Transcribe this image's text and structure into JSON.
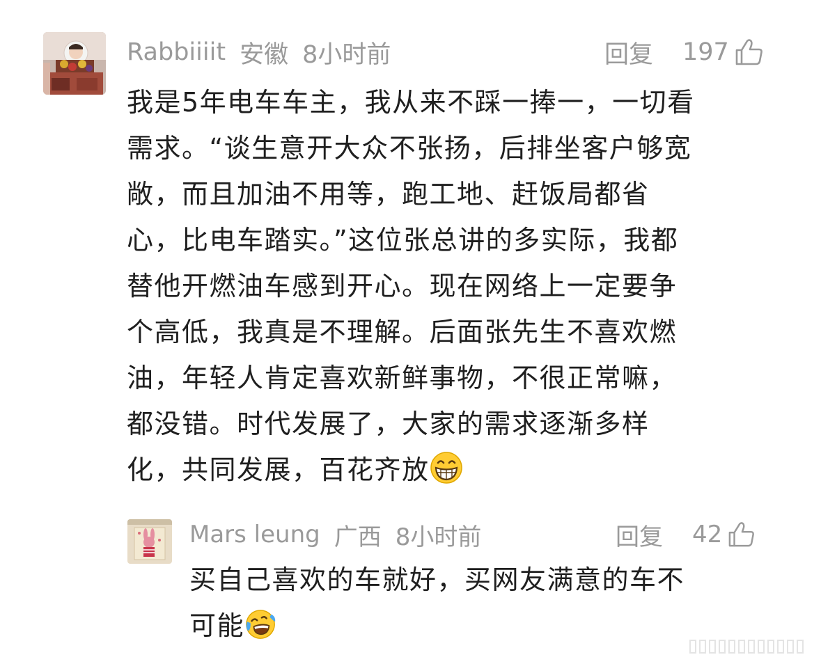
{
  "comment": {
    "username": "Rabbiiiit",
    "location": "安徽",
    "time": "8小时前",
    "reply_label": "回复",
    "likes": "197",
    "lines": [
      "我是5年电车车主，我从来不踩一捧一，一切看",
      "需求。“谈生意开大众不张扬，后排坐客户够宽",
      "敞，而且加油不用等，跑工地、赶饭局都省",
      "心，比电车踏实。”这位张总讲的多实际，我都",
      "替他开燃油车感到开心。现在网络上一定要争",
      "个高低，我真是不理解。后面张先生不喜欢燃",
      "油，年轻人肯定喜欢新鲜事物，不很正常嘛，",
      "都没错。时代发展了，大家的需求逐渐多样",
      "化，共同发展，百花齐放"
    ],
    "end_emoji": "grinning-face-emoji"
  },
  "reply": {
    "username": "Mars leung",
    "location": "广西",
    "time": "8小时前",
    "reply_label": "回复",
    "likes": "42",
    "lines": [
      "买自己喜欢的车就好，买网友满意的车不",
      "可能"
    ],
    "end_emoji": "laughing-crying-emoji"
  },
  "colors": {
    "meta_text": "#9a9a9a",
    "body_text": "#1f1f1f",
    "background": "#ffffff"
  }
}
